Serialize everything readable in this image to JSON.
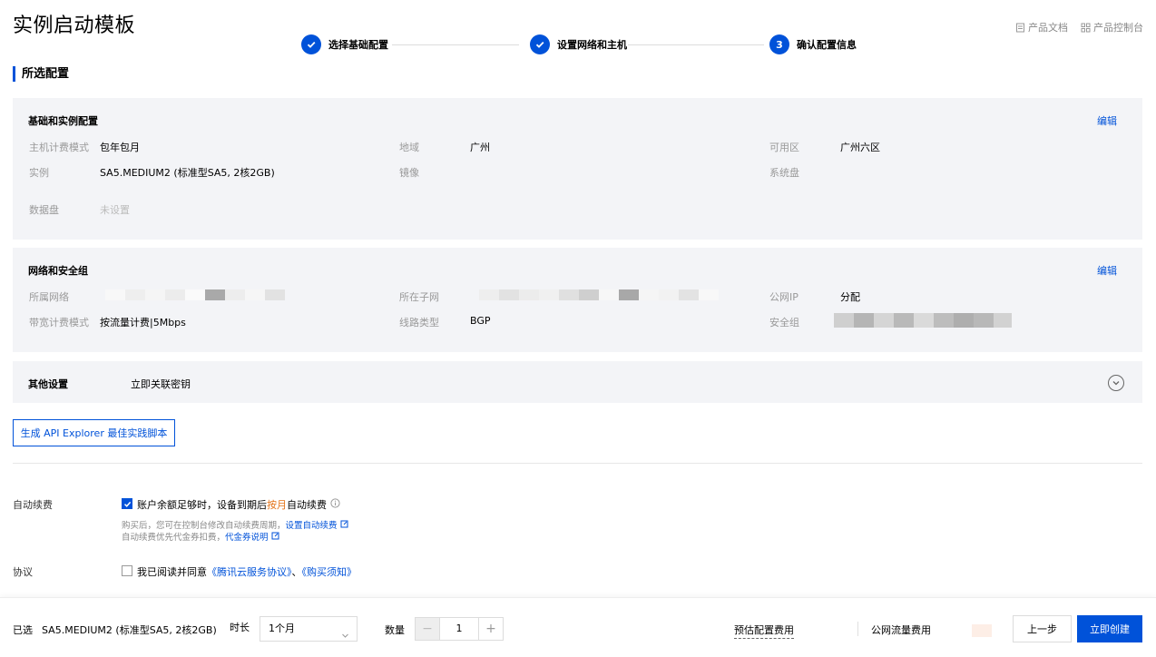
{
  "header": {
    "title": "实例启动模板",
    "links": [
      {
        "label": "产品文档",
        "icon": "document-icon"
      },
      {
        "label": "产品控制台",
        "icon": "grid-icon"
      }
    ]
  },
  "steps": [
    {
      "label": "选择基础配置",
      "state": "done"
    },
    {
      "label": "设置网络和主机",
      "state": "done"
    },
    {
      "number": "3",
      "label": "确认配置信息",
      "state": "current"
    }
  ],
  "section_title": "所选配置",
  "basic": {
    "title": "基础和实例配置",
    "edit": "编辑",
    "billing_label": "主机计费模式",
    "billing_value": "包年包月",
    "region_label": "地域",
    "region_value": "广州",
    "zone_label": "可用区",
    "zone_value": "广州六区",
    "instance_label": "实例",
    "instance_value": "SA5.MEDIUM2 (标准型SA5, 2核2GB)",
    "image_label": "镜像",
    "sysdisk_label": "系统盘",
    "datadisk_label": "数据盘",
    "datadisk_value": "未设置"
  },
  "network": {
    "title": "网络和安全组",
    "edit": "编辑",
    "vpc_label": "所属网络",
    "subnet_label": "所在子网",
    "publicip_label": "公网IP",
    "publicip_value": "分配",
    "bandwidth_label": "带宽计费模式",
    "bandwidth_value": "按流量计费|5Mbps",
    "line_label": "线路类型",
    "line_value": "BGP",
    "sg_label": "安全组"
  },
  "other": {
    "title": "其他设置",
    "value": "立即关联密钥"
  },
  "api_button": "生成 API Explorer 最佳实践脚本",
  "auto_renew": {
    "label": "自动续费",
    "text_before": "账户余额足够时，设备到期后",
    "text_highlight": "按月",
    "text_after": "自动续费",
    "note1": "购买后，您可在控制台修改自动续费周期，",
    "note1_link": "设置自动续费",
    "note2": "自动续费优先代金券扣费，",
    "note2_link": "代金券说明",
    "checked": true
  },
  "agreement": {
    "label": "协议",
    "text": "我已阅读并同意",
    "link1": "《腾讯云服务协议》",
    "sep": "、",
    "link2": "《购买须知》",
    "checked": false
  },
  "footer": {
    "selected_label": "已选",
    "selected_value": "SA5.MEDIUM2 (标准型SA5, 2核2GB)",
    "duration_label": "时长",
    "duration_value": "1个月",
    "quantity_label": "数量",
    "quantity_value": "1",
    "minus": "−",
    "plus": "+",
    "est_fee_label": "预估配置费用",
    "traffic_fee_label": "公网流量费用",
    "prev_button": "上一步",
    "create_button": "立即创建"
  },
  "colors": {
    "primary": "#0052d9",
    "panel_bg": "#f3f4f7",
    "highlight": "#e37318"
  }
}
